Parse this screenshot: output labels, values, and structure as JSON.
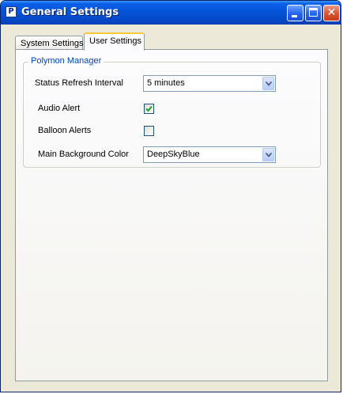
{
  "window": {
    "title": "General Settings",
    "app_icon": "polymon-app-icon",
    "buttons": {
      "minimize": "minimize-icon",
      "maximize": "maximize-icon",
      "close": "close-icon"
    }
  },
  "tabs": [
    {
      "label": "System Settings",
      "selected": false
    },
    {
      "label": "User Settings",
      "selected": true
    }
  ],
  "group": {
    "title": "Polymon Manager"
  },
  "fields": {
    "status_refresh": {
      "label": "Status Refresh Interval",
      "value": "5 minutes"
    },
    "audio_alert": {
      "label": "Audio Alert",
      "checked": true
    },
    "balloon_alerts": {
      "label": "Balloon Alerts",
      "checked": false
    },
    "main_bg_color": {
      "label": "Main Background Color",
      "value": "DeepSkyBlue"
    }
  },
  "colors": {
    "titlebar": "#0553d8",
    "group_title": "#0046d5",
    "check_mark": "#21a121",
    "tab_highlight": "#ffc83c"
  }
}
